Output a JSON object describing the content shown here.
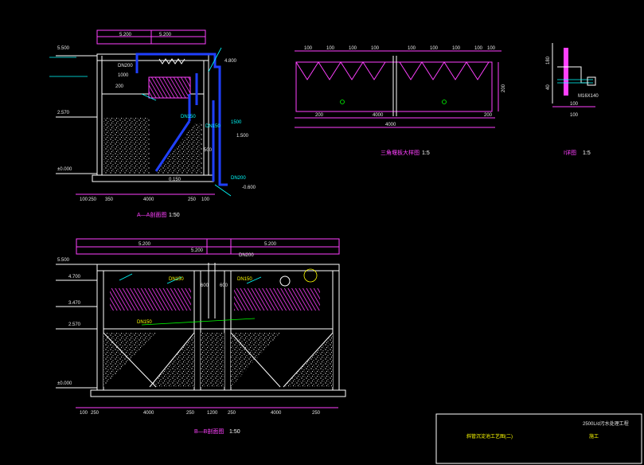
{
  "colors": {
    "background": "#000000",
    "outline": "#ffffff",
    "dim": "#ff40ff",
    "pipe": "#2040ff",
    "leader": "#00ffff",
    "fill": "#cccccc"
  },
  "section_aa": {
    "title": "A—A剖面图",
    "scale": "1:50",
    "top_dims": [
      "5.200",
      "5.200"
    ],
    "elevations": [
      "5.500",
      "4.800",
      "2.570",
      "±0.000",
      "1.500",
      "-0.600",
      "0.150"
    ],
    "bottom_dims": [
      "100",
      "250",
      "350",
      "4000",
      "250",
      "100"
    ],
    "labels": [
      "DN200",
      "1000",
      "DN150",
      "DN200",
      "DN150",
      "1500",
      "500",
      "200"
    ]
  },
  "section_bb": {
    "title": "B—B剖面图",
    "scale": "1:50",
    "top_dims": [
      "5.200",
      "5.200",
      "DN200",
      "5.200"
    ],
    "elevations": [
      "5.500",
      "4.700",
      "3.470",
      "2.570",
      "±0.000"
    ],
    "bottom_dims": [
      "100",
      "250",
      "4000",
      "250",
      "1200",
      "250",
      "4000",
      "250"
    ],
    "labels": [
      "DN150",
      "DN150",
      "600",
      "600",
      "DN150"
    ]
  },
  "detail_triangle": {
    "title": "三角堰板大样图",
    "scale": "1:5",
    "top_dims": [
      "100",
      "100",
      "100",
      "100",
      "100",
      "100",
      "100",
      "100",
      "100"
    ],
    "bottom_dims": [
      "200",
      "4000",
      "4000",
      "200"
    ],
    "side_dim": "200"
  },
  "detail_i": {
    "title": "I详图",
    "scale": "1:5",
    "labels": [
      "100",
      "40",
      "180",
      "100",
      "M16X140"
    ]
  },
  "title_block": {
    "project": "2500L/d污水处理工程",
    "drawing": "斜管沉淀池工艺图(二)",
    "stage": "施工"
  }
}
